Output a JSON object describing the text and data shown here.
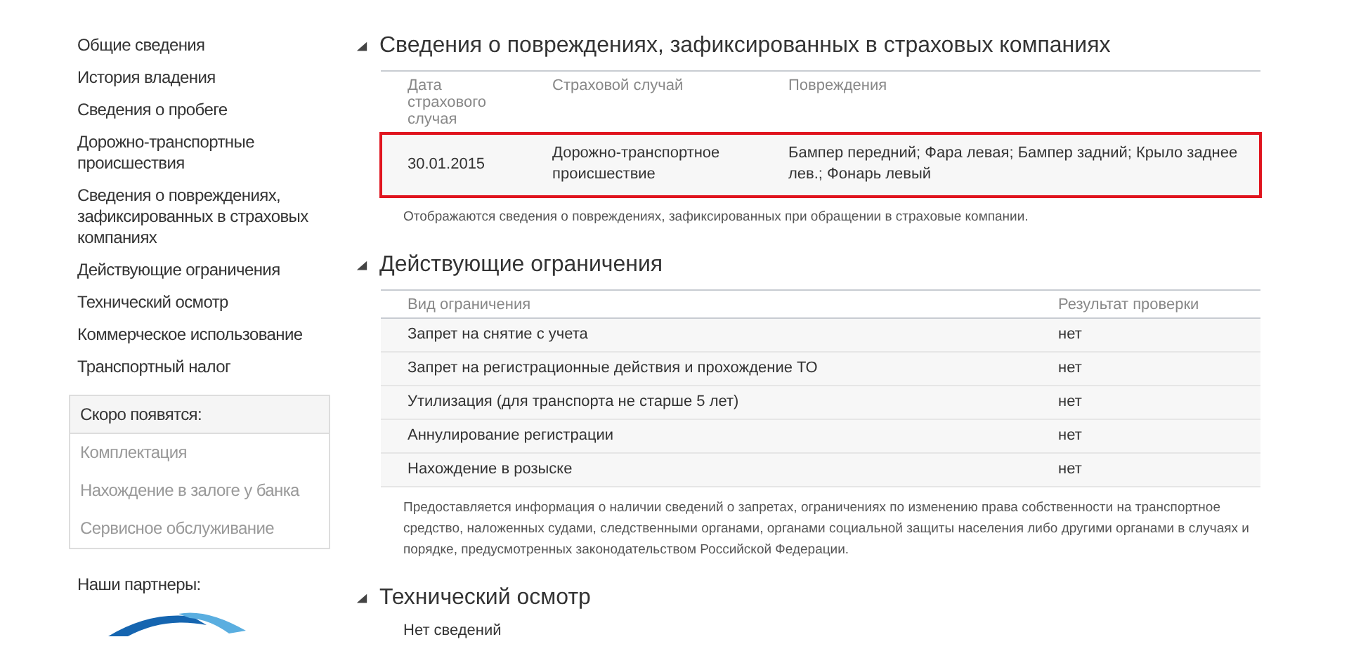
{
  "sidebar": {
    "nav_items": [
      {
        "label": "Общие сведения"
      },
      {
        "label": "История владения"
      },
      {
        "label": "Сведения о пробеге"
      },
      {
        "label": "Дорожно-транспортные происшествия"
      },
      {
        "label": "Сведения о повреждениях, зафиксированных в страховых компаниях"
      },
      {
        "label": "Действующие ограничения"
      },
      {
        "label": "Технический осмотр"
      },
      {
        "label": "Коммерческое использование"
      },
      {
        "label": "Транспортный налог"
      }
    ],
    "coming_soon": {
      "title": "Скоро появятся:",
      "items": [
        "Комплектация",
        "Нахождение в залоге у банка",
        "Сервисное обслуживание"
      ]
    },
    "partners_title": "Наши партнеры:"
  },
  "sections": [
    {
      "kind": "table",
      "title": "Сведения о повреждениях, зафиксированных в страховых компаниях",
      "expanded": true,
      "columns": [
        "Дата страхового случая",
        "Страховой случай",
        "Повреждения"
      ],
      "rows": [
        {
          "cells": [
            "30.01.2015",
            "Дорожно-транспортное происшествие",
            "Бампер передний; Фара левая; Бампер задний; Крыло заднее лев.; Фонарь левый"
          ],
          "highlighted": true
        }
      ],
      "note": "Отображаются сведения о повреждениях, зафиксированных при обращении в страховые компании."
    },
    {
      "kind": "table",
      "title": "Действующие ограничения",
      "expanded": true,
      "columns": [
        "Вид ограничения",
        "Результат проверки"
      ],
      "rows": [
        {
          "cells": [
            "Запрет на снятие с учета",
            "нет"
          ],
          "highlighted": false
        },
        {
          "cells": [
            "Запрет на регистрационные действия и прохождение ТО",
            "нет"
          ],
          "highlighted": false
        },
        {
          "cells": [
            "Утилизация (для транспорта не старше 5 лет)",
            "нет"
          ],
          "highlighted": false
        },
        {
          "cells": [
            "Аннулирование регистрации",
            "нет"
          ],
          "highlighted": false
        },
        {
          "cells": [
            "Нахождение в розыске",
            "нет"
          ],
          "highlighted": false
        }
      ],
      "note": "Предоставляется информация о наличии сведений о запретах, ограничениях по изменению права собственности на транспортное средство, наложенных судами, следственными органами, органами социальной защиты населения либо другими органами в случаях и порядке, предусмотренных законодательством Российской Федерации."
    },
    {
      "kind": "text",
      "title": "Технический осмотр",
      "expanded": true,
      "text": "Нет сведений"
    }
  ]
}
